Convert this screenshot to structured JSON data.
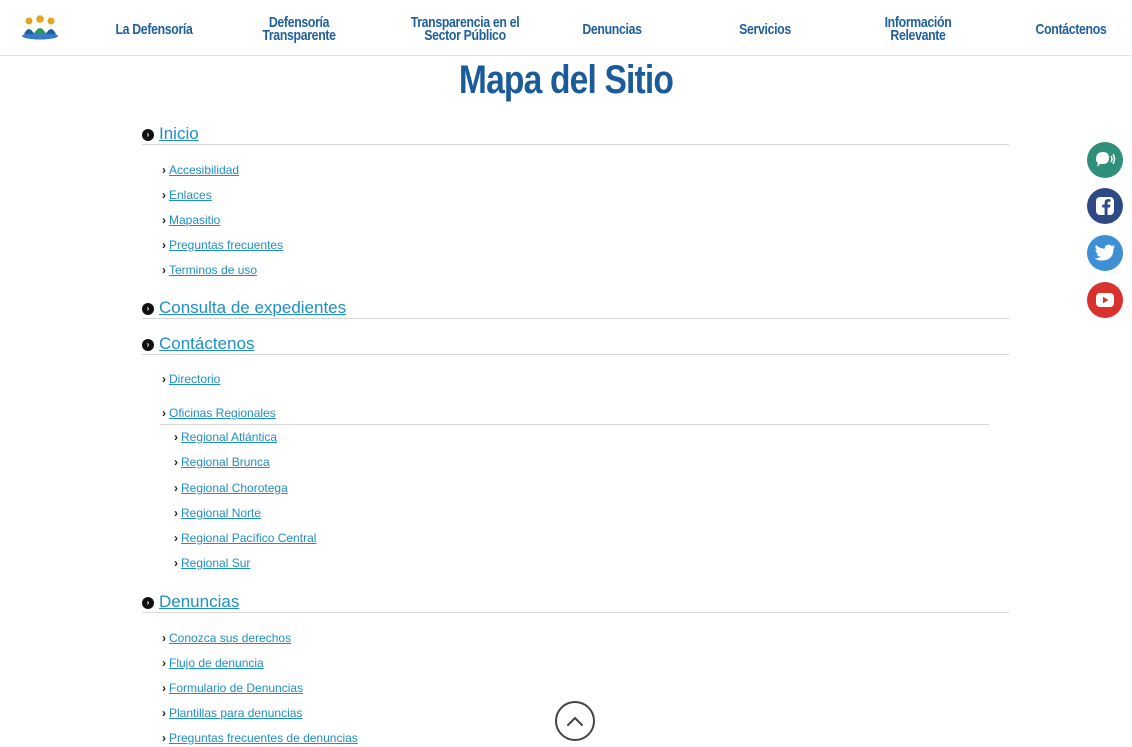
{
  "nav": {
    "logo": "logo",
    "items": [
      "La Defensoría",
      "Defensoría\nTransparente",
      "Transparencia en el\nSector Público",
      "Denuncias",
      "Servicios",
      "Información\nRelevante",
      "Contáctenos"
    ]
  },
  "page": {
    "title": "Mapa del Sitio"
  },
  "sitemap": {
    "inicio": {
      "label": "Inicio",
      "children": [
        "Accesibilidad",
        "Enlaces",
        "Mapasitio",
        "Preguntas frecuentes",
        "Terminos de uso"
      ]
    },
    "consulta": {
      "label": "Consulta de expedientes"
    },
    "contactenos": {
      "label": "Contáctenos",
      "children": [
        "Directorio",
        "Oficinas Regionales"
      ],
      "regionales": [
        "Regional Atlántica",
        "Regional Brunca",
        "Regional Chorotega",
        "Regional Norte",
        "Regional Pacífico Central",
        "Regional Sur"
      ]
    },
    "denuncias": {
      "label": "Denuncias",
      "children": [
        "Conozca sus derechos",
        "Flujo de denuncia",
        "Formulario de Denuncias",
        "Plantillas para denuncias",
        "Preguntas frecuentes de denuncias"
      ]
    }
  },
  "social": [
    "accessibility-voice-icon",
    "facebook-icon",
    "twitter-icon",
    "youtube-icon"
  ],
  "colors": {
    "nav_text": "#1f5f9b",
    "link": "#1f8fc6",
    "title": "#1c5b9a",
    "voice": "#2f8f7a",
    "facebook": "#2d4a86",
    "twitter": "#3d8fd6",
    "youtube": "#d8322e"
  }
}
